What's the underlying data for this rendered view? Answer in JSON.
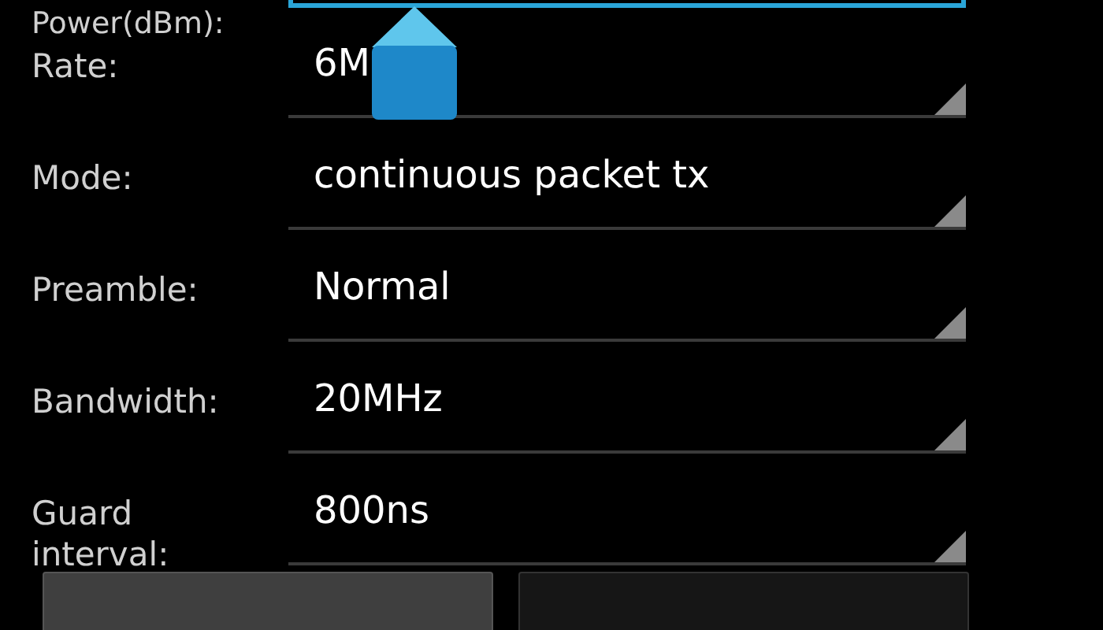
{
  "power": {
    "label": "Power(dBm):"
  },
  "rows": [
    {
      "label": "Rate:",
      "value": "6M"
    },
    {
      "label": "Mode:",
      "value": "continuous packet tx"
    },
    {
      "label": "Preamble:",
      "value": "Normal"
    },
    {
      "label": "Bandwidth:",
      "value": "20MHz"
    },
    {
      "label": "Guard interval:",
      "value": "800ns"
    }
  ],
  "buttons": [
    {
      "kind": "light"
    },
    {
      "kind": "dark"
    }
  ]
}
